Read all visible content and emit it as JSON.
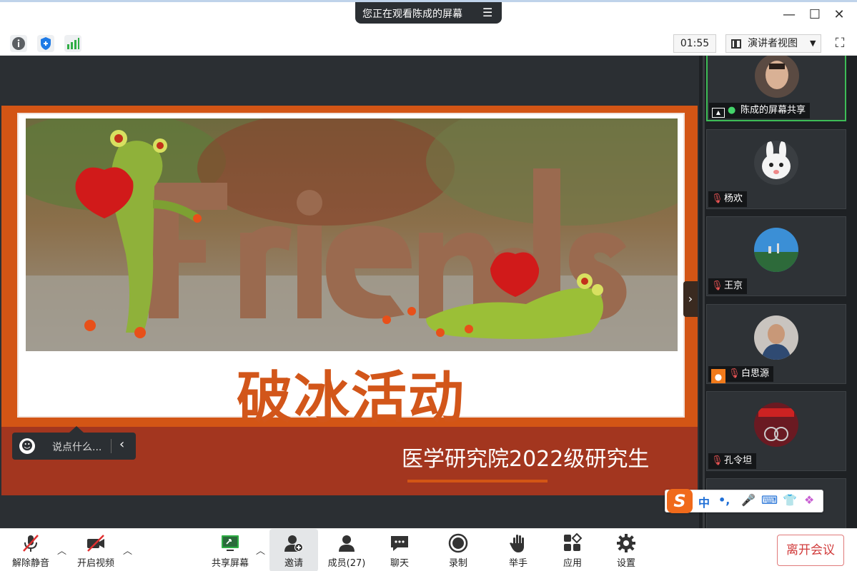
{
  "titlebar": {
    "sharing_notice": "您正在观看陈成的屏幕"
  },
  "status": {
    "timer": "01:55",
    "view_mode": "演讲者视图"
  },
  "slide": {
    "title": "破冰活动",
    "subtitle": "医学研究院2022级研究生",
    "photo_word": "Friends"
  },
  "chat_hint": "说点什么...",
  "participants": [
    {
      "name": "陈成的屏幕共享",
      "mic": "on",
      "sharing": true
    },
    {
      "name": "杨欢",
      "mic": "muted"
    },
    {
      "name": "王京",
      "mic": "muted"
    },
    {
      "name": "白思源",
      "mic": "muted",
      "host": true
    },
    {
      "name": "孔令坦",
      "mic": "muted"
    }
  ],
  "ime": {
    "mode": "中",
    "punct": "•,"
  },
  "toolbar": {
    "mute": "解除静音",
    "video": "开启视频",
    "share": "共享屏幕",
    "invite": "邀请",
    "members": "成员(27)",
    "chat": "聊天",
    "record": "录制",
    "raise_hand": "举手",
    "apps": "应用",
    "settings": "设置",
    "leave": "离开会议"
  },
  "colors": {
    "accent_orange": "#d35515",
    "slide_dark": "#a3361f",
    "leave_red": "#d13b3b",
    "active_green": "#3dbd56"
  }
}
